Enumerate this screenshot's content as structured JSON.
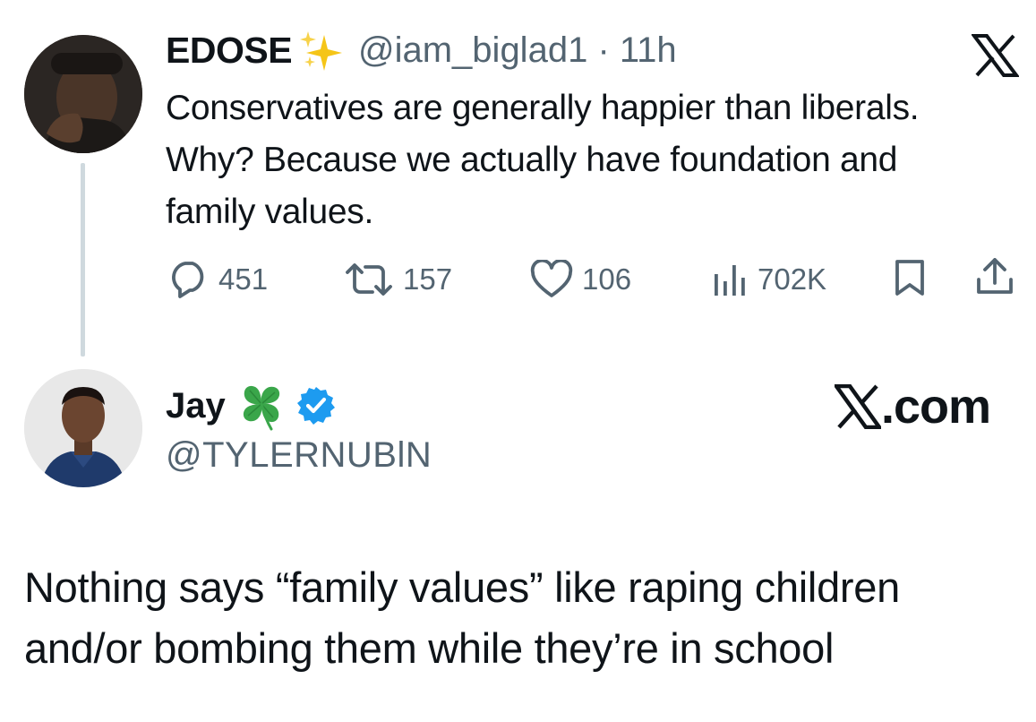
{
  "quoted_tweet": {
    "display_name": "EDOSE",
    "handle": "@iam_biglad1",
    "separator": "·",
    "time": "11h",
    "text": "Conservatives are generally happier than liberals. Why? Because we actually have foundation and family values.",
    "stats": {
      "replies": "451",
      "retweets": "157",
      "likes": "106",
      "views": "702K"
    },
    "icons": [
      "sparkles-emoji",
      "x-logo-icon",
      "reply-icon",
      "retweet-icon",
      "like-icon",
      "views-icon",
      "bookmark-icon",
      "share-icon"
    ]
  },
  "reply_tweet": {
    "display_name": "Jay",
    "handle": "@TYLERNUBlN",
    "text": "Nothing says “family values” like raping children and/or bombing them while they’re in school",
    "icons": [
      "four-leaf-clover-emoji",
      "verified-badge-icon"
    ]
  },
  "branding": {
    "site_label": ".com"
  },
  "colors": {
    "text": "#0f1419",
    "secondary": "#536471",
    "verified": "#1d9bf0",
    "thread_line": "#cfd9de",
    "sparkle": "#f5c518",
    "clover": "#3aa64a"
  }
}
